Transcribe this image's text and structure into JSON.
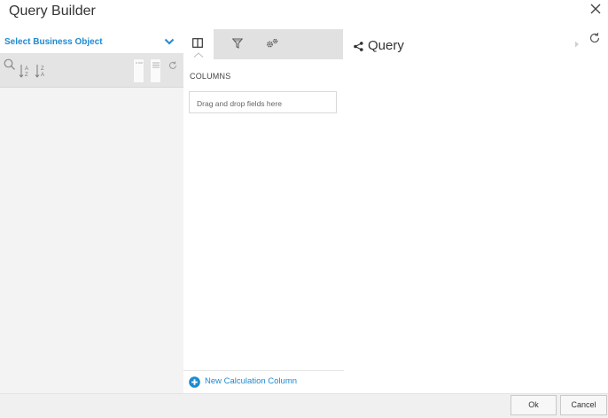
{
  "dialog": {
    "title": "Query Builder"
  },
  "left_panel": {
    "business_object_label": "Select Business Object"
  },
  "middle_panel": {
    "tabs": [
      {
        "name": "columns",
        "icon": "columns-icon",
        "active": true
      },
      {
        "name": "filters",
        "icon": "filter-icon",
        "active": false
      },
      {
        "name": "settings",
        "icon": "gears-icon",
        "active": false
      }
    ],
    "section_label": "COLUMNS",
    "drop_placeholder": "Drag and drop fields here",
    "new_calc_label": "New Calculation Column"
  },
  "right_panel": {
    "title": "Query"
  },
  "footer": {
    "ok_label": "Ok",
    "cancel_label": "Cancel"
  },
  "colors": {
    "accent": "#1e8ad1",
    "panel_bg": "#f3f3f3",
    "tab_bar_bg": "#e1e1e1"
  }
}
